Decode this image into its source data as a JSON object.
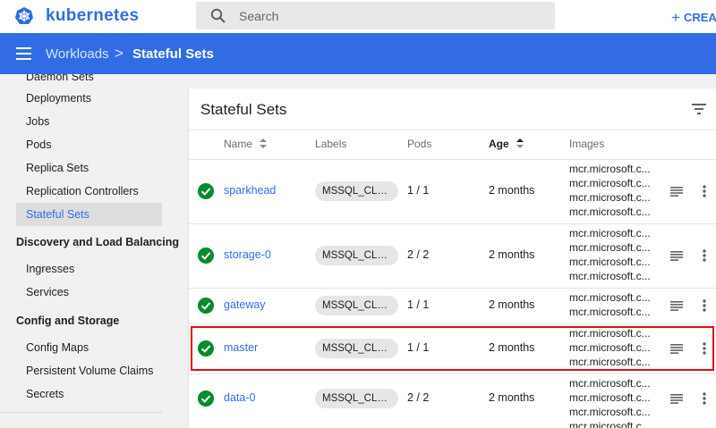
{
  "app": {
    "brand": "kubernetes",
    "create_label": "CREATE"
  },
  "search": {
    "placeholder": "Search"
  },
  "breadcrumb": {
    "parent": "Workloads",
    "separator": ">",
    "current": "Stateful Sets"
  },
  "sidebar": {
    "items_top": [
      "Daemon Sets",
      "Deployments",
      "Jobs",
      "Pods",
      "Replica Sets",
      "Replication Controllers",
      "Stateful Sets"
    ],
    "active_item": "Stateful Sets",
    "section_discovery": "Discovery and Load Balancing",
    "discovery_items": [
      "Ingresses",
      "Services"
    ],
    "section_config": "Config and Storage",
    "config_items": [
      "Config Maps",
      "Persistent Volume Claims",
      "Secrets"
    ]
  },
  "card": {
    "title": "Stateful Sets",
    "columns": {
      "name": "Name",
      "labels": "Labels",
      "pods": "Pods",
      "age": "Age",
      "images": "Images"
    }
  },
  "rows": [
    {
      "name": "sparkhead",
      "label": "MSSQL_CLUST...",
      "pods": "1 / 1",
      "age": "2 months",
      "images": [
        "mcr.microsoft.c...",
        "mcr.microsoft.c...",
        "mcr.microsoft.c...",
        "mcr.microsoft.c..."
      ]
    },
    {
      "name": "storage-0",
      "label": "MSSQL_CLUST...",
      "pods": "2 / 2",
      "age": "2 months",
      "images": [
        "mcr.microsoft.c...",
        "mcr.microsoft.c...",
        "mcr.microsoft.c...",
        "mcr.microsoft.c..."
      ]
    },
    {
      "name": "gateway",
      "label": "MSSQL_CLUST...",
      "pods": "1 / 1",
      "age": "2 months",
      "images": [
        "mcr.microsoft.c...",
        "mcr.microsoft.c..."
      ]
    },
    {
      "name": "master",
      "label": "MSSQL_CLUST...",
      "pods": "1 / 1",
      "age": "2 months",
      "images": [
        "mcr.microsoft.c...",
        "mcr.microsoft.c...",
        "mcr.microsoft.c..."
      ]
    },
    {
      "name": "data-0",
      "label": "MSSQL_CLUST...",
      "pods": "2 / 2",
      "age": "2 months",
      "images": [
        "mcr.microsoft.c...",
        "mcr.microsoft.c...",
        "mcr.microsoft.c...",
        "mcr.microsoft.c..."
      ]
    }
  ],
  "colors": {
    "brand_blue": "#326ce5",
    "status_ok": "#0a8a2e",
    "highlight_red": "#e00f0f"
  },
  "icons": {
    "logo": "kubernetes-wheel-icon",
    "search": "search-icon",
    "menu": "menu-icon",
    "filter": "filter-icon",
    "status": "check-circle-icon",
    "logs": "logs-icon",
    "more": "more-vert-icon",
    "sort": "sort-icon"
  }
}
